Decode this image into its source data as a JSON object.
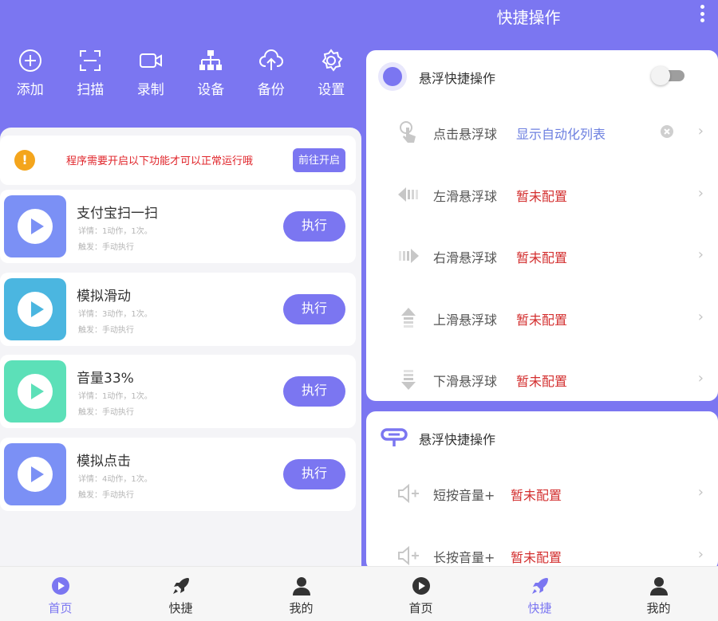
{
  "left": {
    "toolbar": [
      {
        "label": "添加",
        "icon": "add-icon"
      },
      {
        "label": "扫描",
        "icon": "scan-icon"
      },
      {
        "label": "录制",
        "icon": "record-icon"
      },
      {
        "label": "设备",
        "icon": "device-icon"
      },
      {
        "label": "备份",
        "icon": "backup-icon"
      },
      {
        "label": "设置",
        "icon": "settings-icon"
      }
    ],
    "notice": {
      "text": "程序需要开启以下功能才可以正常运行哦",
      "button": "前往开启",
      "icon": "warning-icon"
    },
    "tasks": [
      {
        "name": "支付宝扫一扫",
        "detail": "详情：1动作，1次。",
        "trigger": "触发：手动执行",
        "button": "执行",
        "color": "#7B90F5"
      },
      {
        "name": "模拟滑动",
        "detail": "详情：3动作，1次。",
        "trigger": "触发：手动执行",
        "button": "执行",
        "color": "#4BB6E0"
      },
      {
        "name": "音量33%",
        "detail": "详情：1动作，1次。",
        "trigger": "触发：手动执行",
        "button": "执行",
        "color": "#5CE0B8"
      },
      {
        "name": "模拟点击",
        "detail": "详情：4动作，1次。",
        "trigger": "触发：手动执行",
        "button": "执行",
        "color": "#7B90F5"
      }
    ],
    "nav": [
      {
        "label": "首页",
        "icon": "home-play-icon",
        "active": true
      },
      {
        "label": "快捷",
        "icon": "rocket-icon",
        "active": false
      },
      {
        "label": "我的",
        "icon": "user-icon",
        "active": false
      }
    ]
  },
  "right": {
    "title": "快捷操作",
    "card1": {
      "header": "悬浮快捷操作",
      "toggle_on": false,
      "rows": [
        {
          "label": "点击悬浮球",
          "value": "显示自动化列表",
          "value_color": "#6C7FE0",
          "icon": "tap-icon",
          "clear": true
        },
        {
          "label": "左滑悬浮球",
          "value": "暂未配置",
          "value_color": "#D32F2F",
          "icon": "swipe-left-icon"
        },
        {
          "label": "右滑悬浮球",
          "value": "暂未配置",
          "value_color": "#D32F2F",
          "icon": "swipe-right-icon"
        },
        {
          "label": "上滑悬浮球",
          "value": "暂未配置",
          "value_color": "#D32F2F",
          "icon": "swipe-up-icon"
        },
        {
          "label": "下滑悬浮球",
          "value": "暂未配置",
          "value_color": "#D32F2F",
          "icon": "swipe-down-icon"
        }
      ]
    },
    "card2": {
      "header": "悬浮快捷操作",
      "rows": [
        {
          "label": "短按音量+",
          "value": "暂未配置",
          "value_color": "#D32F2F",
          "icon": "volume-up-icon"
        },
        {
          "label": "长按音量+",
          "value": "暂未配置",
          "value_color": "#D32F2F",
          "icon": "volume-up-icon"
        }
      ]
    },
    "nav": [
      {
        "label": "首页",
        "icon": "home-play-icon",
        "active": false
      },
      {
        "label": "快捷",
        "icon": "rocket-icon",
        "active": true
      },
      {
        "label": "我的",
        "icon": "user-icon",
        "active": false
      }
    ]
  }
}
